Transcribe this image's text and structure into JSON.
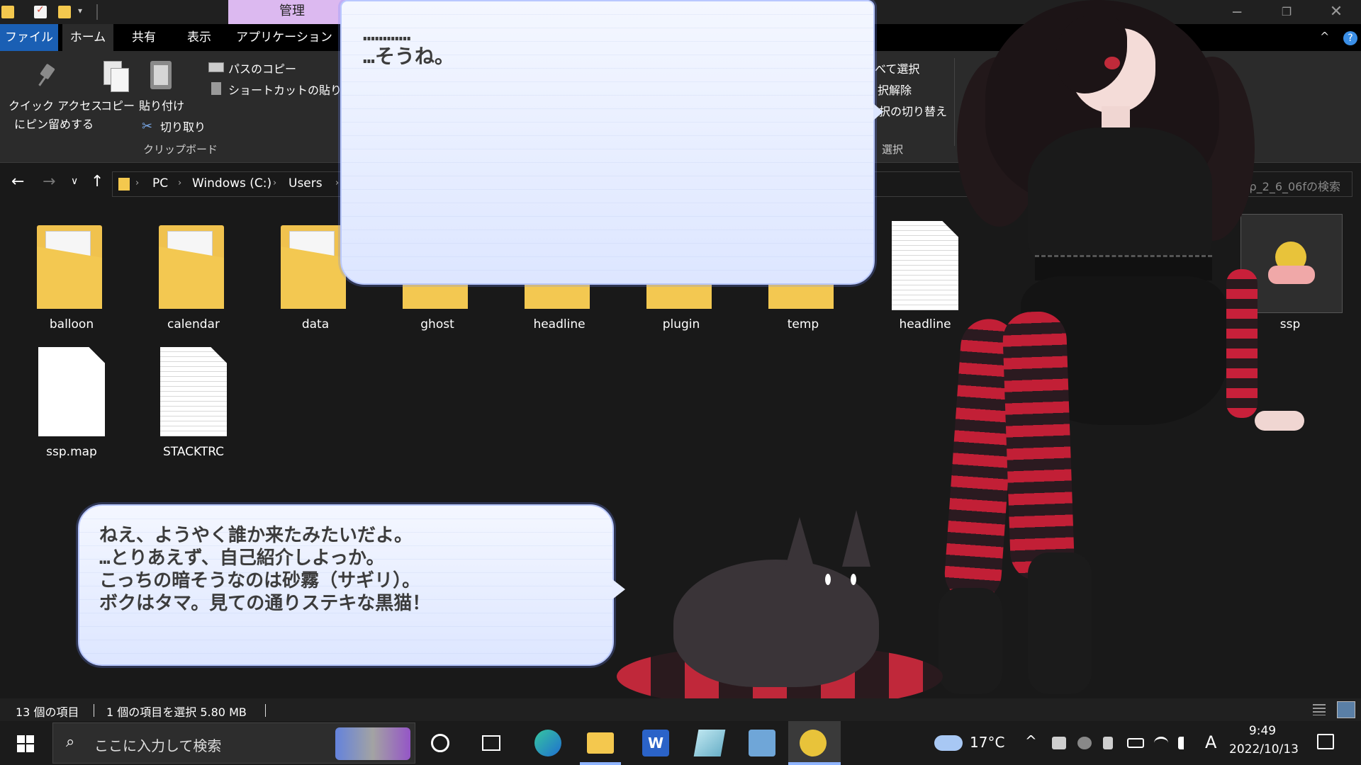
{
  "titlebar": {
    "context_tab": "管理",
    "dropdown_glyph": "▾",
    "minimize_glyph": "─",
    "restore_glyph": "❐",
    "close_glyph": "✕"
  },
  "ribbon_tabs": {
    "file": "ファイル",
    "home": "ホーム",
    "share": "共有",
    "view": "表示",
    "app_tools": "アプリケーション ツー",
    "collapse_glyph": "^",
    "help_glyph": "?"
  },
  "ribbon": {
    "pin_line1": "クイック アクセス",
    "pin_line2": "にピン留めする",
    "copy": "コピー",
    "paste": "貼り付け",
    "cut": "切り取り",
    "cut_glyph": "✂",
    "copy_path": "パスのコピー",
    "paste_shortcut": "ショートカットの貼り付け",
    "clipboard_group": "クリップボード",
    "select_all": "べて選択",
    "select_none": "択解除",
    "invert_selection": "択の切り替え",
    "select_group": "選択"
  },
  "address": {
    "back_glyph": "←",
    "forward_glyph": "→",
    "recent_glyph": "∨",
    "up_glyph": "↑",
    "crumb_sep": "›",
    "crumbs": [
      "PC",
      "Windows (C:)",
      "Users"
    ],
    "search_placeholder": "sp_2_6_06fの検索"
  },
  "files": [
    {
      "name": "balloon",
      "type": "folder"
    },
    {
      "name": "calendar",
      "type": "folder"
    },
    {
      "name": "data",
      "type": "folder"
    },
    {
      "name": "ghost",
      "type": "folder"
    },
    {
      "name": "headline",
      "type": "folder"
    },
    {
      "name": "plugin",
      "type": "folder"
    },
    {
      "name": "temp",
      "type": "folder"
    },
    {
      "name": "headline",
      "type": "file"
    },
    {
      "name": "ssp",
      "type": "application",
      "selected": true
    },
    {
      "name": "ssp.map",
      "type": "file"
    },
    {
      "name": "STACKTRC",
      "type": "file"
    }
  ],
  "balloons": {
    "top": "…………\n…そうね。",
    "bottom": "ねえ、ようやく誰か来たみたいだよ。\n…とりあえず、自己紹介しよっか。\nこっちの暗そうなのは砂霧（サギリ）。\nボクはタマ。見ての通りステキな黒猫！"
  },
  "statusbar": {
    "item_count": "13 個の項目",
    "selection": "1 個の項目を選択  5.80 MB"
  },
  "taskbar": {
    "search_icon_glyph": "⌕",
    "search_placeholder": "ここに入力して検索",
    "word_letter": "W",
    "weather": "17°C",
    "tray_chevron": "^",
    "ime": "A",
    "time": "9:49",
    "date": "2022/10/13"
  },
  "colors": {
    "accent": "#1a5fb4",
    "context_tab": "#dcb9f0",
    "folder": "#f0c24e",
    "balloon": "#e4ebff"
  }
}
